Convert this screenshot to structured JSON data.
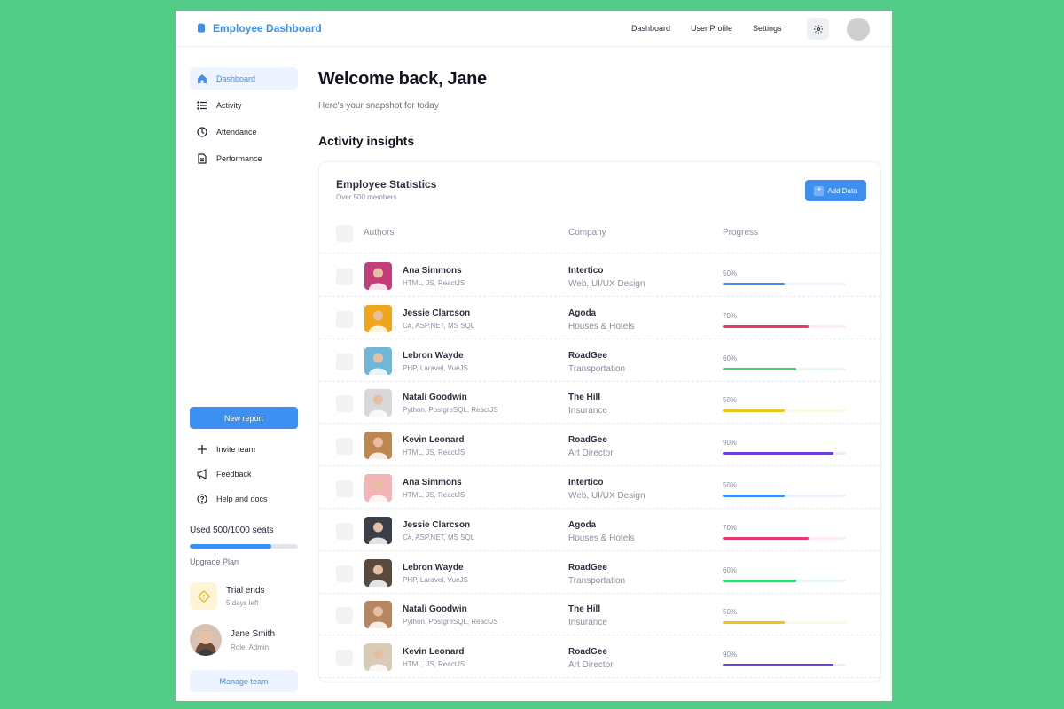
{
  "header": {
    "app_title": "Employee Dashboard",
    "nav": [
      "Dashboard",
      "User Profile",
      "Settings"
    ]
  },
  "sidebar": {
    "items": [
      {
        "label": "Dashboard",
        "icon": "home-icon",
        "active": true
      },
      {
        "label": "Activity",
        "icon": "list-icon",
        "active": false
      },
      {
        "label": "Attendance",
        "icon": "clock-icon",
        "active": false
      },
      {
        "label": "Performance",
        "icon": "document-icon",
        "active": false
      }
    ],
    "new_report": "New report",
    "utility": [
      {
        "label": "Invite team",
        "icon": "plus-icon"
      },
      {
        "label": "Feedback",
        "icon": "megaphone-icon"
      },
      {
        "label": "Help and docs",
        "icon": "help-icon"
      }
    ],
    "seats": {
      "label": "Used 500/1000 seats",
      "used": 500,
      "total": 1000
    },
    "upgrade": "Upgrade Plan",
    "trial": {
      "title": "Trial ends",
      "subtitle": "5 days left"
    },
    "user": {
      "name": "Jane Smith",
      "role": "Role: Admin"
    },
    "manage_team": "Manage team"
  },
  "main": {
    "welcome": "Welcome back, Jane",
    "snapshot": "Here's your snapshot for today",
    "section_title": "Activity insights",
    "card": {
      "title": "Employee Statistics",
      "subtitle": "Over 500 members",
      "add_button": "Add Data",
      "columns": [
        "Authors",
        "Company",
        "Progress"
      ],
      "rows": [
        {
          "name": "Ana Simmons",
          "skills": "HTML, JS, ReactJS",
          "company": "Intertico",
          "industry": "Web, UI/UX Design",
          "progress": 50,
          "progress_label": "50%",
          "color": "#3d8ff2",
          "track": "#eaf3ff",
          "avatar_bg": "#c43d7a"
        },
        {
          "name": "Jessie Clarcson",
          "skills": "C#, ASP.NET, MS SQL",
          "company": "Agoda",
          "industry": "Houses & Hotels",
          "progress": 70,
          "progress_label": "70%",
          "color": "#eb3a6a",
          "track": "#fdebf0",
          "avatar_bg": "#f0a51c"
        },
        {
          "name": "Lebron Wayde",
          "skills": "PHP, Laravel, VueJS",
          "company": "RoadGee",
          "industry": "Transportation",
          "progress": 60,
          "progress_label": "60%",
          "color": "#3ecf73",
          "track": "#e8faef",
          "avatar_bg": "#6fb7d8"
        },
        {
          "name": "Natali Goodwin",
          "skills": "Python, PostgreSQL, ReactJS",
          "company": "The Hill",
          "industry": "Insurance",
          "progress": 50,
          "progress_label": "50%",
          "color": "#f2c21a",
          "track": "#fef8e2",
          "avatar_bg": "#d8d8da"
        },
        {
          "name": "Kevin Leonard",
          "skills": "HTML, JS, ReactJS",
          "company": "RoadGee",
          "industry": "Art Director",
          "progress": 90,
          "progress_label": "90%",
          "color": "#6b3fe0",
          "track": "#f0ebfc",
          "avatar_bg": "#c08652"
        },
        {
          "name": "Ana Simmons",
          "skills": "HTML, JS, ReactJS",
          "company": "Intertico",
          "industry": "Web, UI/UX Design",
          "progress": 50,
          "progress_label": "50%",
          "color": "#3d8ff2",
          "track": "#eaf3ff",
          "avatar_bg": "#f4b3b4"
        },
        {
          "name": "Jessie Clarcson",
          "skills": "C#, ASP.NET, MS SQL",
          "company": "Agoda",
          "industry": "Houses & Hotels",
          "progress": 70,
          "progress_label": "70%",
          "color": "#eb3a6a",
          "track": "#fdebf0",
          "avatar_bg": "#3b3f4a"
        },
        {
          "name": "Lebron Wayde",
          "skills": "PHP, Laravel, VueJS",
          "company": "RoadGee",
          "industry": "Transportation",
          "progress": 60,
          "progress_label": "60%",
          "color": "#3ecf73",
          "track": "#e8faef",
          "avatar_bg": "#5a4a3e"
        },
        {
          "name": "Natali Goodwin",
          "skills": "Python, PostgreSQL, ReactJS",
          "company": "The Hill",
          "industry": "Insurance",
          "progress": 50,
          "progress_label": "50%",
          "color": "#f2c21a",
          "track": "#fef8e2",
          "avatar_bg": "#b8865e"
        },
        {
          "name": "Kevin Leonard",
          "skills": "HTML, JS, ReactJS",
          "company": "RoadGee",
          "industry": "Art Director",
          "progress": 90,
          "progress_label": "90%",
          "color": "#6b3fe0",
          "track": "#f0ebfc",
          "avatar_bg": "#d9cbb6"
        }
      ]
    }
  }
}
